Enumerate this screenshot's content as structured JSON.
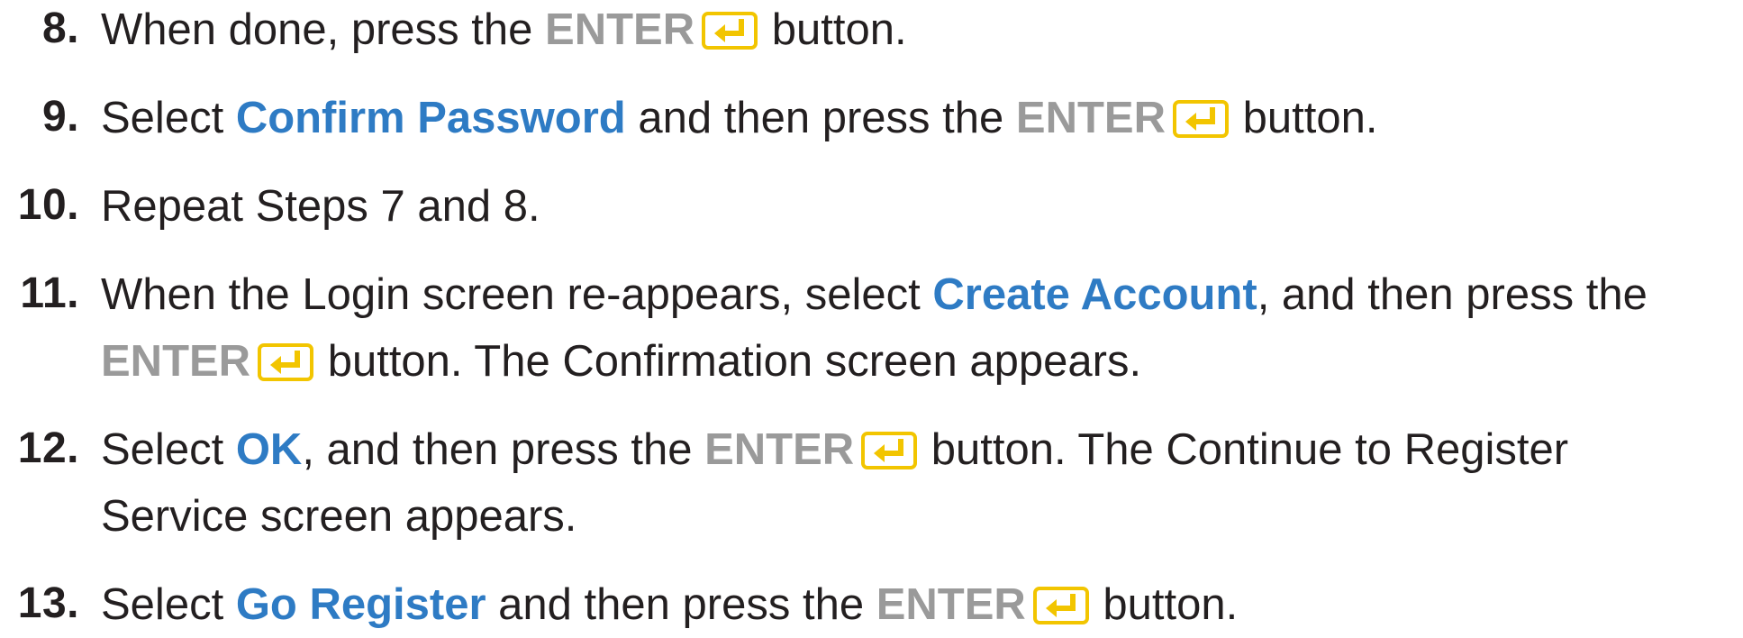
{
  "icons": {
    "enter": "enter-return-icon",
    "enter_color": "#f2c500"
  },
  "colors": {
    "text": "#231f20",
    "highlight": "#2e7bc4",
    "enter_label": "#9a9a9a"
  },
  "steps": [
    {
      "number": "8.",
      "t1": "When done, press the",
      "enter": "ENTER",
      "t2": "button."
    },
    {
      "number": "9.",
      "t1": "Select",
      "hl": "Confirm Password",
      "t2": "and then press the",
      "enter": "ENTER",
      "t3": "button."
    },
    {
      "number": "10.",
      "t1": "Repeat Steps 7 and 8."
    },
    {
      "number": "11.",
      "t1": "When the Login screen re-appears, select",
      "hl": "Create Account",
      "t2": ", and then press the",
      "enter": "ENTER",
      "t3": "button. The Confirmation screen appears."
    },
    {
      "number": "12.",
      "t1": "Select",
      "hl": "OK",
      "t2": ", and then press the",
      "enter": "ENTER",
      "t3": "button. The Continue to Register",
      "t4": "Service screen appears."
    },
    {
      "number": "13.",
      "t1": "Select",
      "hl": "Go Register",
      "t2": "and then press the",
      "enter": "ENTER",
      "t3": "button."
    }
  ]
}
